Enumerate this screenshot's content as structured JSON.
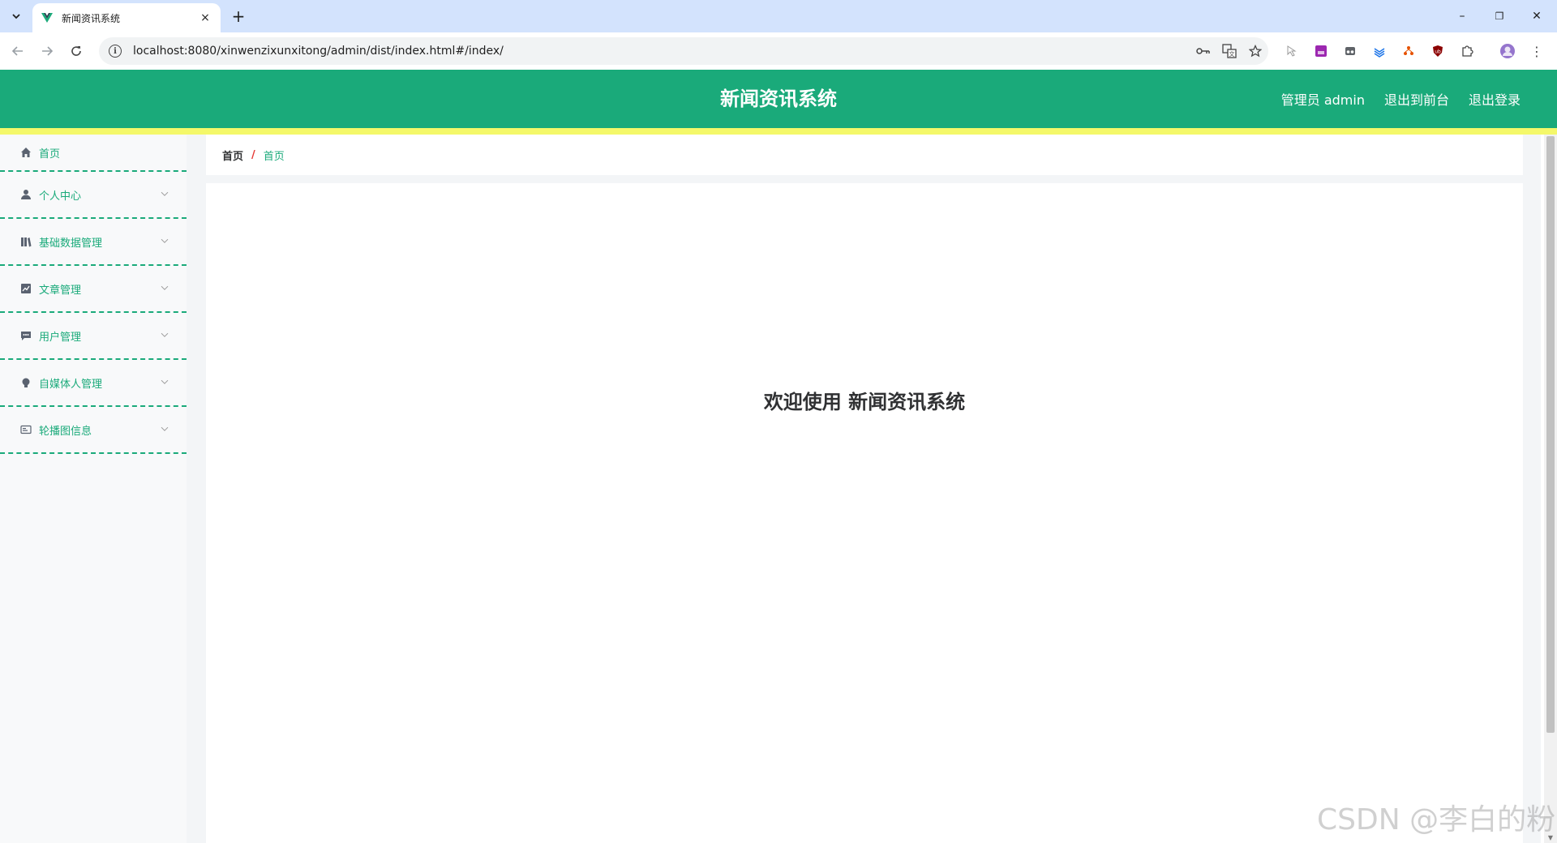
{
  "browser": {
    "tab_title": "新闻资讯系统",
    "tab_close": "×",
    "new_tab": "+",
    "url": "localhost:8080/xinwenzixunxitong/admin/dist/index.html#/index/",
    "window_controls": {
      "minimize": "–",
      "restore": "❐",
      "close": "✕"
    }
  },
  "header": {
    "title": "新闻资讯系统",
    "user": "管理员 admin",
    "front_link": "退出到前台",
    "logout_link": "退出登录",
    "colors": {
      "primary": "#1aaa7a",
      "accent_bar": "#f4f86a"
    }
  },
  "sidebar": {
    "items": [
      {
        "label": "首页",
        "icon": "home-icon"
      },
      {
        "label": "个人中心",
        "icon": "user-icon"
      },
      {
        "label": "基础数据管理",
        "icon": "library-icon"
      },
      {
        "label": "文章管理",
        "icon": "chart-icon"
      },
      {
        "label": "用户管理",
        "icon": "message-icon"
      },
      {
        "label": "自媒体人管理",
        "icon": "bulb-icon"
      },
      {
        "label": "轮播图信息",
        "icon": "picture-icon"
      }
    ]
  },
  "breadcrumb": {
    "home": "首页",
    "separator": "/",
    "current": "首页"
  },
  "main": {
    "welcome": "欢迎使用 新闻资讯系统"
  },
  "watermark": "CSDN @李白的粉"
}
